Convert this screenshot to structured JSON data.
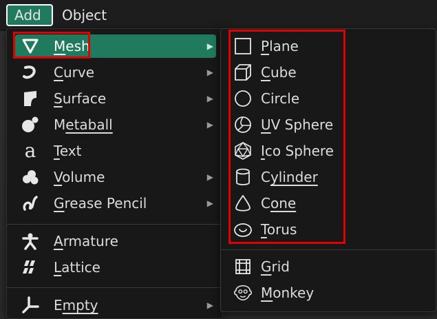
{
  "menubar": {
    "tabs": [
      {
        "label": "Add",
        "active": true
      },
      {
        "label": "Object",
        "active": false
      }
    ]
  },
  "main_menu": {
    "items": [
      {
        "label_first": "M",
        "label_rest": "esh",
        "icon": "mesh-icon",
        "has_submenu": true,
        "highlighted": true
      },
      {
        "label_first": "C",
        "label_rest": "urve",
        "icon": "curve-icon",
        "has_submenu": true
      },
      {
        "label_first": "S",
        "label_rest": "urface",
        "icon": "surface-icon",
        "has_submenu": true
      },
      {
        "label_first": "M",
        "label_rest": "etaball",
        "icon": "metaball-icon",
        "has_submenu": true
      },
      {
        "label_first": "T",
        "label_rest": "ext",
        "icon": "text-icon",
        "has_submenu": false
      },
      {
        "label_first": "V",
        "label_rest": "olume",
        "icon": "volume-icon",
        "has_submenu": true
      },
      {
        "label_first": "G",
        "label_rest": "rease Pencil",
        "icon": "grease-pencil-icon",
        "has_submenu": true
      },
      {
        "label_first": "A",
        "label_rest": "rmature",
        "icon": "armature-icon",
        "has_submenu": false
      },
      {
        "label_first": "L",
        "label_rest": "attice",
        "icon": "lattice-icon",
        "has_submenu": false
      },
      {
        "label_first": "E",
        "label_rest": "mpty",
        "icon": "empty-icon",
        "has_submenu": true
      }
    ]
  },
  "mesh_submenu": {
    "items": [
      {
        "label_first": "P",
        "label_rest": "lane",
        "icon": "plane-icon"
      },
      {
        "label_first": "C",
        "label_rest": "ube",
        "icon": "cube-icon"
      },
      {
        "label_first": "C",
        "label_rest": "ircle",
        "label_underline_index": 3,
        "icon": "circle-icon"
      },
      {
        "label_first": "U",
        "label_rest": "V Sphere",
        "icon": "uv-sphere-icon"
      },
      {
        "label_first": "I",
        "label_rest": "co Sphere",
        "icon": "ico-sphere-icon"
      },
      {
        "label_first": "C",
        "label_rest": "ylinder",
        "label_underline_index": 1,
        "icon": "cylinder-icon"
      },
      {
        "label_first": "C",
        "label_rest": "one",
        "label_underline_index": 1,
        "icon": "cone-icon"
      },
      {
        "label_first": "T",
        "label_rest": "orus",
        "icon": "torus-icon"
      },
      {
        "label_first": "G",
        "label_rest": "rid",
        "icon": "grid-icon"
      },
      {
        "label_first": "M",
        "label_rest": "onkey",
        "icon": "monkey-icon"
      }
    ]
  },
  "colors": {
    "accent": "#1f7a5e",
    "menu_bg": "#181818",
    "annotation_red": "#e30000"
  }
}
